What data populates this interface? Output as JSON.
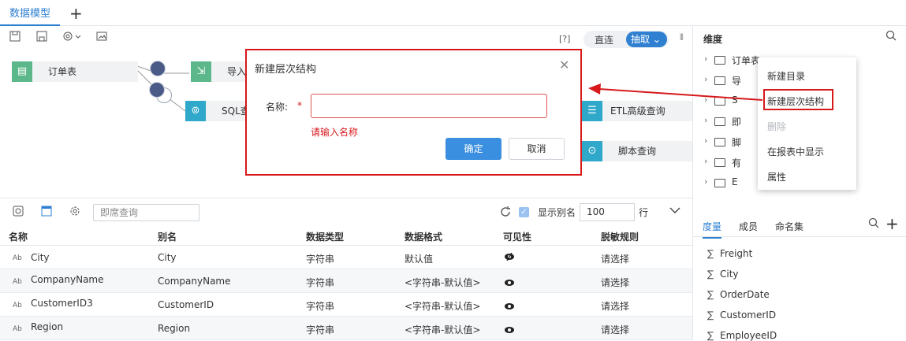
{
  "tabs": {
    "active": "数据模型",
    "add": "+"
  },
  "toolbar": {
    "help": "[?]",
    "mode_direct": "直连",
    "mode_extract": "抽取"
  },
  "nodes": {
    "order_table": "订单表",
    "import": "导入",
    "sql": "SQL查",
    "etl": "ETL高级查询",
    "script": "脚本查询"
  },
  "subtoolbar": {
    "search_placeholder": "即席查询",
    "show_alias": "显示别名",
    "rows": "100",
    "rows_unit": "行"
  },
  "table": {
    "headers": [
      "名称",
      "别名",
      "数据类型",
      "数据格式",
      "可见性",
      "脱敏规则"
    ],
    "rows": [
      {
        "name": "City",
        "alias": "City",
        "type": "字符串",
        "format": "默认值",
        "mask": "请选择"
      },
      {
        "name": "CompanyName",
        "alias": "CompanyName",
        "type": "字符串",
        "format": "<字符串-默认值>",
        "mask": "请选择"
      },
      {
        "name": "CustomerID3",
        "alias": "CustomerID",
        "type": "字符串",
        "format": "<字符串-默认值>",
        "mask": "请选择"
      },
      {
        "name": "Region",
        "alias": "Region",
        "type": "字符串",
        "format": "<字符串-默认值>",
        "mask": "请选择"
      }
    ]
  },
  "right_panel": {
    "title": "维度",
    "tree": [
      "订单表",
      "导",
      "S",
      "即",
      "脚",
      "有",
      "E"
    ],
    "tabs": [
      "度量",
      "成员",
      "命名集"
    ],
    "measures": [
      "Freight",
      "City",
      "OrderDate",
      "CustomerID",
      "EmployeeID"
    ]
  },
  "context_menu": {
    "items": [
      "新建目录",
      "新建层次结构",
      "删除",
      "在报表中显示",
      "属性"
    ]
  },
  "dialog": {
    "title": "新建层次结构",
    "name_label": "名称:",
    "required": "*",
    "input_value": "",
    "error": "请输入名称",
    "ok": "确定",
    "cancel": "取消"
  },
  "colors": {
    "accent": "#2f80d1",
    "highlight": "#d7191c"
  }
}
